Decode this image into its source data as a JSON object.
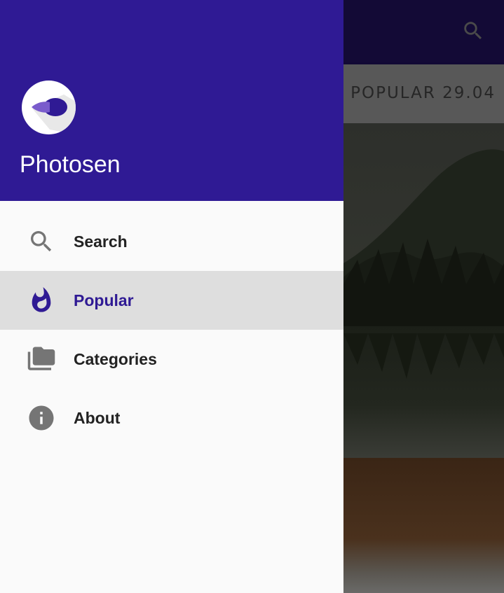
{
  "background": {
    "header_title": "POPULAR 29.04",
    "search_icon": "search-icon",
    "colors": {
      "toolbar": "#130a36",
      "header": "#585858"
    }
  },
  "drawer": {
    "app_name": "Photosen",
    "logo_icon": "photosen-logo-icon",
    "colors": {
      "header": "#2f1a94",
      "accent": "#2f1a94",
      "selected_bg": "#dedede"
    },
    "items": [
      {
        "label": "Search",
        "icon": "search-icon",
        "selected": false
      },
      {
        "label": "Popular",
        "icon": "fire-icon",
        "selected": true
      },
      {
        "label": "Categories",
        "icon": "folders-icon",
        "selected": false
      },
      {
        "label": "About",
        "icon": "info-icon",
        "selected": false
      }
    ]
  }
}
